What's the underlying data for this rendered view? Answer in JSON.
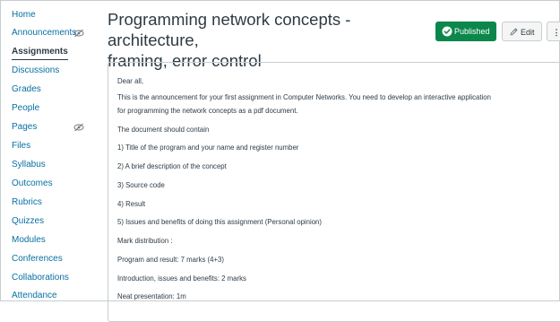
{
  "sidebar": {
    "items": [
      {
        "label": "Home",
        "hidden": false,
        "active": false
      },
      {
        "label": "Announcements",
        "hidden": true,
        "active": false
      },
      {
        "label": "Assignments",
        "hidden": false,
        "active": true
      },
      {
        "label": "Discussions",
        "hidden": false,
        "active": false
      },
      {
        "label": "Grades",
        "hidden": false,
        "active": false
      },
      {
        "label": "People",
        "hidden": false,
        "active": false
      },
      {
        "label": "Pages",
        "hidden": true,
        "active": false
      },
      {
        "label": "Files",
        "hidden": false,
        "active": false
      },
      {
        "label": "Syllabus",
        "hidden": false,
        "active": false
      },
      {
        "label": "Outcomes",
        "hidden": false,
        "active": false
      },
      {
        "label": "Rubrics",
        "hidden": false,
        "active": false
      },
      {
        "label": "Quizzes",
        "hidden": false,
        "active": false
      },
      {
        "label": "Modules",
        "hidden": false,
        "active": false
      },
      {
        "label": "Conferences",
        "hidden": false,
        "active": false
      },
      {
        "label": "Collaborations",
        "hidden": false,
        "active": false
      },
      {
        "label": "Attendance",
        "hidden": false,
        "active": false
      }
    ]
  },
  "header": {
    "title_line1": "Programming network concepts - architecture,",
    "title_line2": "framing, error control",
    "published_label": "Published",
    "edit_label": "Edit",
    "more_label": "⋮"
  },
  "content": {
    "lines": [
      "Dear all,",
      "This is the announcement for your first assignment in Computer Networks. You need to develop an interactive  application",
      "for programming the network concepts as a pdf document.",
      "The document should contain",
      "1) Title of the program and your name and register number",
      "2) A brief description of the concept",
      "3) Source code",
      "4) Result",
      "5) Issues and benefits of doing this assignment (Personal opinion)",
      "Mark distribution :",
      "Program and result: 7 marks (4+3)",
      "Introduction, issues and benefits: 2 marks",
      "Neat presentation: 1m"
    ]
  },
  "colors": {
    "link": "#0770a3",
    "text": "#2d3b45",
    "published": "#0b874b",
    "border": "#c7cdd1"
  },
  "icons": {
    "hidden_indicator": "eye-slash-icon",
    "published": "check-circle-icon",
    "edit": "pencil-icon",
    "more": "kebab-menu-icon"
  }
}
